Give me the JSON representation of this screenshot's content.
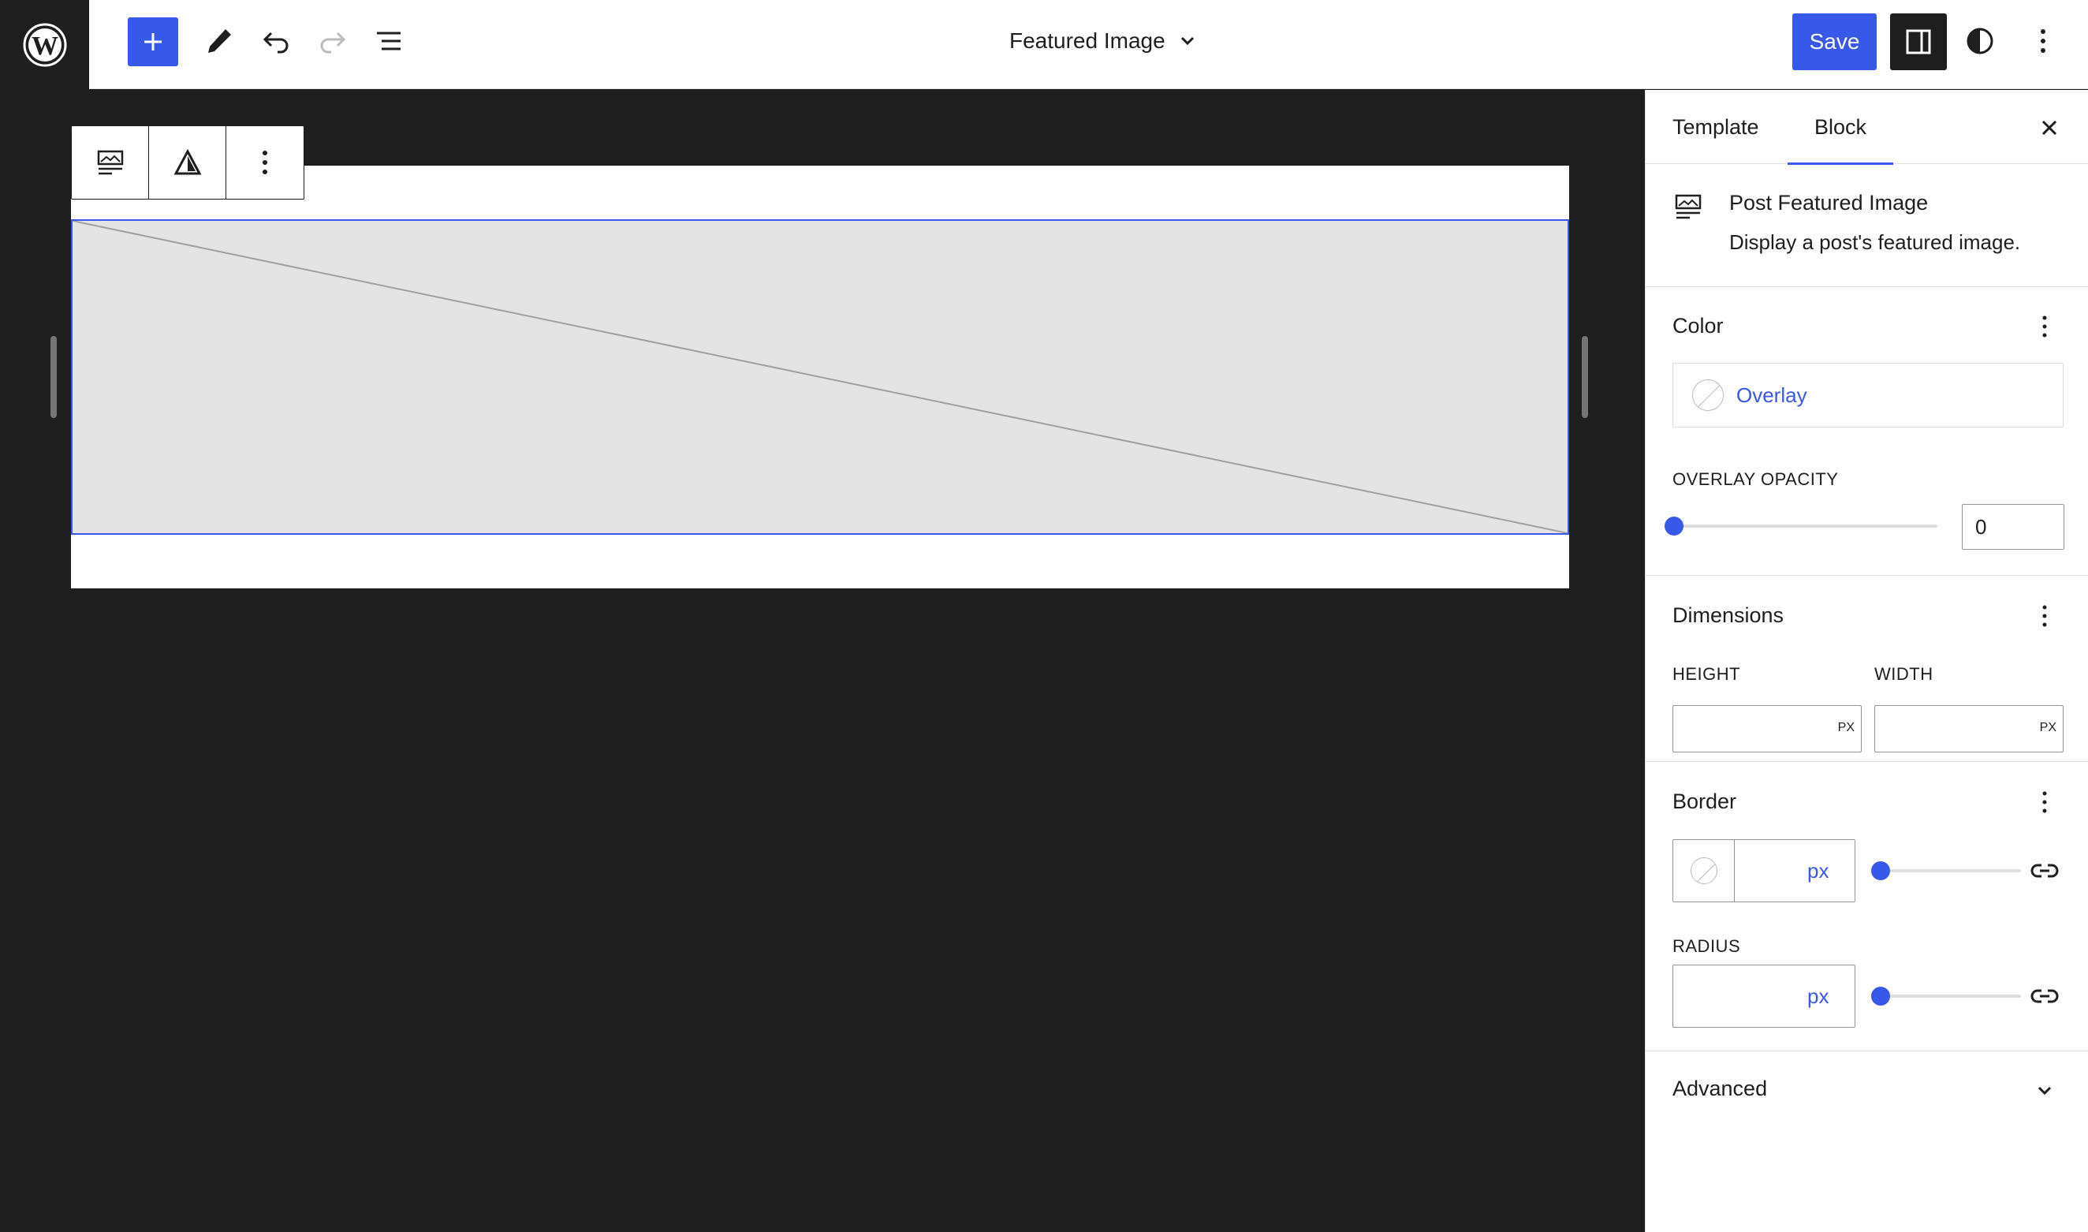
{
  "header": {
    "add_label": "+",
    "document_title": "Featured Image",
    "save_label": "Save"
  },
  "sidebar": {
    "tabs": [
      {
        "label": "Template"
      },
      {
        "label": "Block"
      }
    ],
    "block_card": {
      "title": "Post Featured Image",
      "description": "Display a post's featured image."
    },
    "color": {
      "title": "Color",
      "overlay_label": "Overlay",
      "opacity_label": "OVERLAY OPACITY",
      "opacity_value": "0"
    },
    "dimensions": {
      "title": "Dimensions",
      "height_label": "HEIGHT",
      "width_label": "WIDTH",
      "height_unit": "PX",
      "width_unit": "PX"
    },
    "border": {
      "title": "Border",
      "width_unit": "px",
      "radius_label": "RADIUS",
      "radius_unit": "px"
    },
    "advanced": {
      "title": "Advanced"
    }
  },
  "colors": {
    "accent": "#3858e9",
    "canvas_bg": "#1e1e1e",
    "placeholder_bg": "#e4e4e4"
  }
}
